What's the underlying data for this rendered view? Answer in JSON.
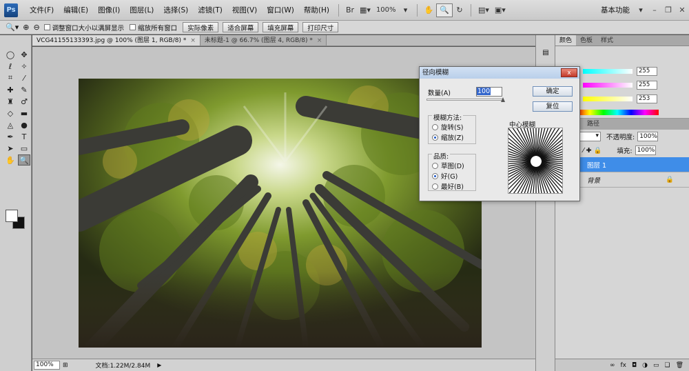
{
  "app": {
    "logo": "Ps",
    "workspace": "基本功能"
  },
  "menu": [
    "文件(F)",
    "编辑(E)",
    "图像(I)",
    "图层(L)",
    "选择(S)",
    "滤镜(T)",
    "视图(V)",
    "窗口(W)",
    "帮助(H)"
  ],
  "menubar": {
    "zoom": "100%",
    "br_label": "Br"
  },
  "options": {
    "resize_label": "调整窗口大小以满屏显示",
    "zoom_all_label": "缩放所有窗口",
    "actual_pixels": "实际像素",
    "fit_screen": "适合屏幕",
    "fill_screen": "填充屏幕",
    "print_size": "打印尺寸"
  },
  "tabs": [
    {
      "label": "VCG41155133393.jpg @ 100% (图层 1, RGB/8) *",
      "active": true
    },
    {
      "label": "未标题-1 @ 66.7% (图层 4, RGB/8) *",
      "active": false
    }
  ],
  "status": {
    "zoom": "100%",
    "doc": "文档:1.22M/2.84M"
  },
  "color_panel": {
    "tabs": [
      "颜色",
      "色板",
      "样式"
    ],
    "sliders": [
      {
        "letter": "R",
        "value": "255",
        "color": "#ff4a4a"
      },
      {
        "letter": "G",
        "value": "255",
        "color": "#4aff4a"
      },
      {
        "letter": "B",
        "value": "253",
        "color": "#4a6aff"
      }
    ]
  },
  "layers_panel": {
    "tabs": [
      "通道",
      "路径"
    ],
    "opacity_label": "不透明度:",
    "opacity_value": "100%",
    "fill_label": "填充:",
    "fill_value": "100%",
    "layers": [
      {
        "name": "图层 1",
        "selected": true
      },
      {
        "name": "背景",
        "selected": false
      }
    ]
  },
  "dialog": {
    "title": "径向模糊",
    "close": "x",
    "amount_label": "数量(A)",
    "amount_value": "100",
    "amount_fraction": 1.0,
    "ok": "确定",
    "reset": "复位",
    "method_label": "模糊方法:",
    "methods": [
      "旋转(S)",
      "缩放(Z)"
    ],
    "method_selected": 1,
    "quality_label": "品质:",
    "qualities": [
      "草图(D)",
      "好(G)",
      "最好(B)"
    ],
    "quality_selected": 1,
    "center_label": "中心模糊"
  }
}
